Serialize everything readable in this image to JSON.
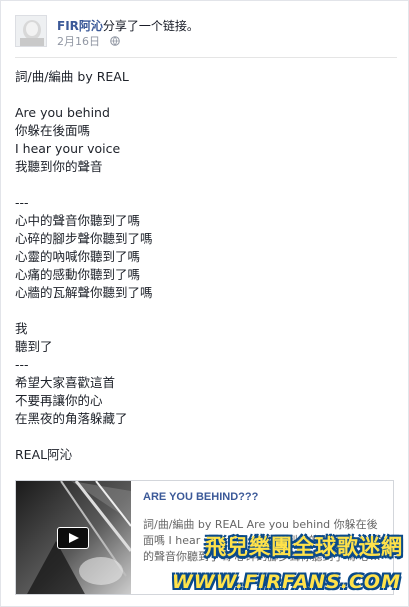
{
  "post": {
    "author": "FIR阿沁",
    "action": "分享了一个链接。",
    "date": "2月16日",
    "privacy_icon": "globe-icon",
    "lines": [
      "詞/曲/編曲 by REAL",
      "",
      "Are you behind",
      "你躲在後面嗎",
      "I hear your voice",
      "我聽到你的聲音",
      "",
      "---",
      "心中的聲音你聽到了嗎",
      "心碎的腳步聲你聽到了嗎",
      "心靈的吶喊你聽到了嗎",
      "心痛的感動你聽到了嗎",
      "心牆的瓦解聲你聽到了嗎",
      "",
      "我",
      "聽到了",
      "---",
      "希望大家喜歡這首",
      "不要再讓你的心",
      "在黑夜的角落躲藏了",
      "",
      "REAL阿沁"
    ]
  },
  "link_card": {
    "title": "ARE YOU BEHIND???",
    "description": "詞/曲/編曲 by REAL Are you behind 你躲在後面嗎 I hear your voice 我聽到你的聲音 --- 心中的聲音你聽到了嗎 心碎的腳步聲你聽到了嗎 心...",
    "play_icon": "play-icon"
  },
  "watermark": {
    "line1": "飛兒樂團全球歌迷網",
    "line2": "WWW.FIRFANS.COM"
  },
  "colors": {
    "link_blue": "#3b5998",
    "meta_gray": "#9197a3",
    "watermark_yellow": "#ffe24a",
    "watermark_outline": "#0a4a8a"
  }
}
